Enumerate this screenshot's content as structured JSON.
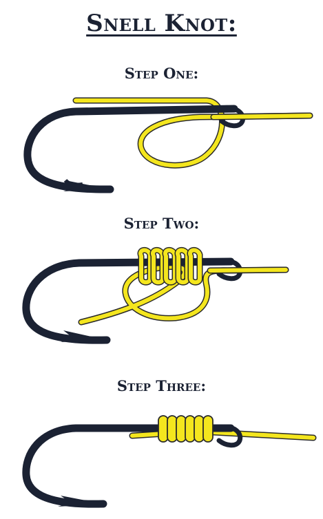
{
  "title": "Snell Knot:",
  "steps": [
    {
      "label": "Step One:"
    },
    {
      "label": "Step Two:"
    },
    {
      "label": "Step Three:"
    }
  ],
  "colors": {
    "hook": "#1b2233",
    "line": "#f4e61e",
    "line_outline": "#2a2a2a"
  }
}
